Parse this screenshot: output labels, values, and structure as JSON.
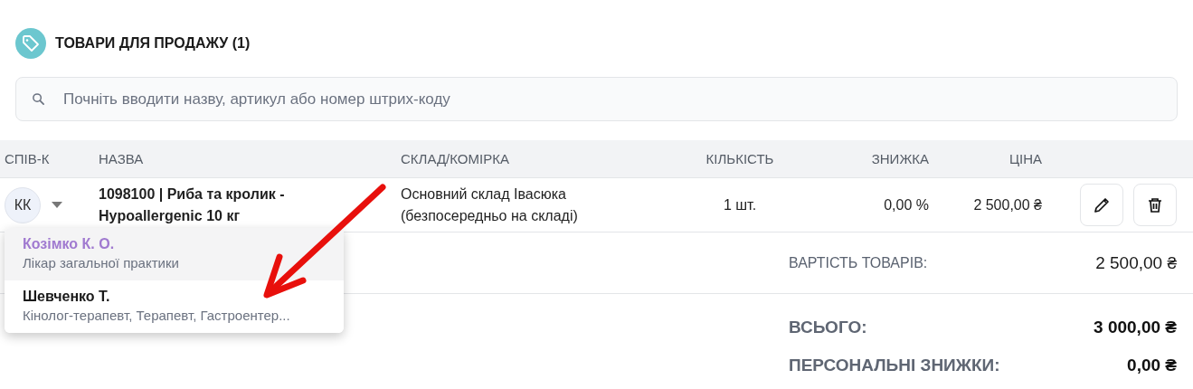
{
  "section": {
    "title": "ТОВАРИ ДЛЯ ПРОДАЖУ (1)"
  },
  "search": {
    "placeholder": "Почніть вводити назву, артикул або номер штрих-коду"
  },
  "table": {
    "columns": [
      "СПІВ-К",
      "НАЗВА",
      "СКЛАД/КОМІРКА",
      "КІЛЬКІСТЬ",
      "ЗНИЖКА",
      "ЦІНА"
    ],
    "rows": [
      {
        "employee": "КК",
        "name": "1098100 | Риба та кролик - Hypoallergenic 10 кг",
        "warehouse": "Основний склад Івасюка (безпосередньо на складі)",
        "quantity": "1 шт.",
        "discount": "0,00 %",
        "price": "2 500,00 ₴"
      }
    ]
  },
  "employee_dropdown": {
    "expanded": true,
    "items": [
      {
        "name": "Козімко К. О.",
        "role": "Лікар загальної практики",
        "selected": true
      },
      {
        "name": "Шевченко Т.",
        "role": "Кінолог-терапевт, Терапевт, Гастроентер...",
        "selected": false
      }
    ]
  },
  "summary": [
    {
      "label": "ВАРТІСТЬ ТОВАРІВ:",
      "value": "2 500,00 ₴",
      "kind": "subtotal"
    },
    {
      "label": "ВСЬОГО:",
      "value": "3 000,00 ₴",
      "kind": "total"
    },
    {
      "label": "ПЕРСОНАЛЬНІ ЗНИЖКИ:",
      "value": "0,00 ₴",
      "kind": "total"
    }
  ]
}
